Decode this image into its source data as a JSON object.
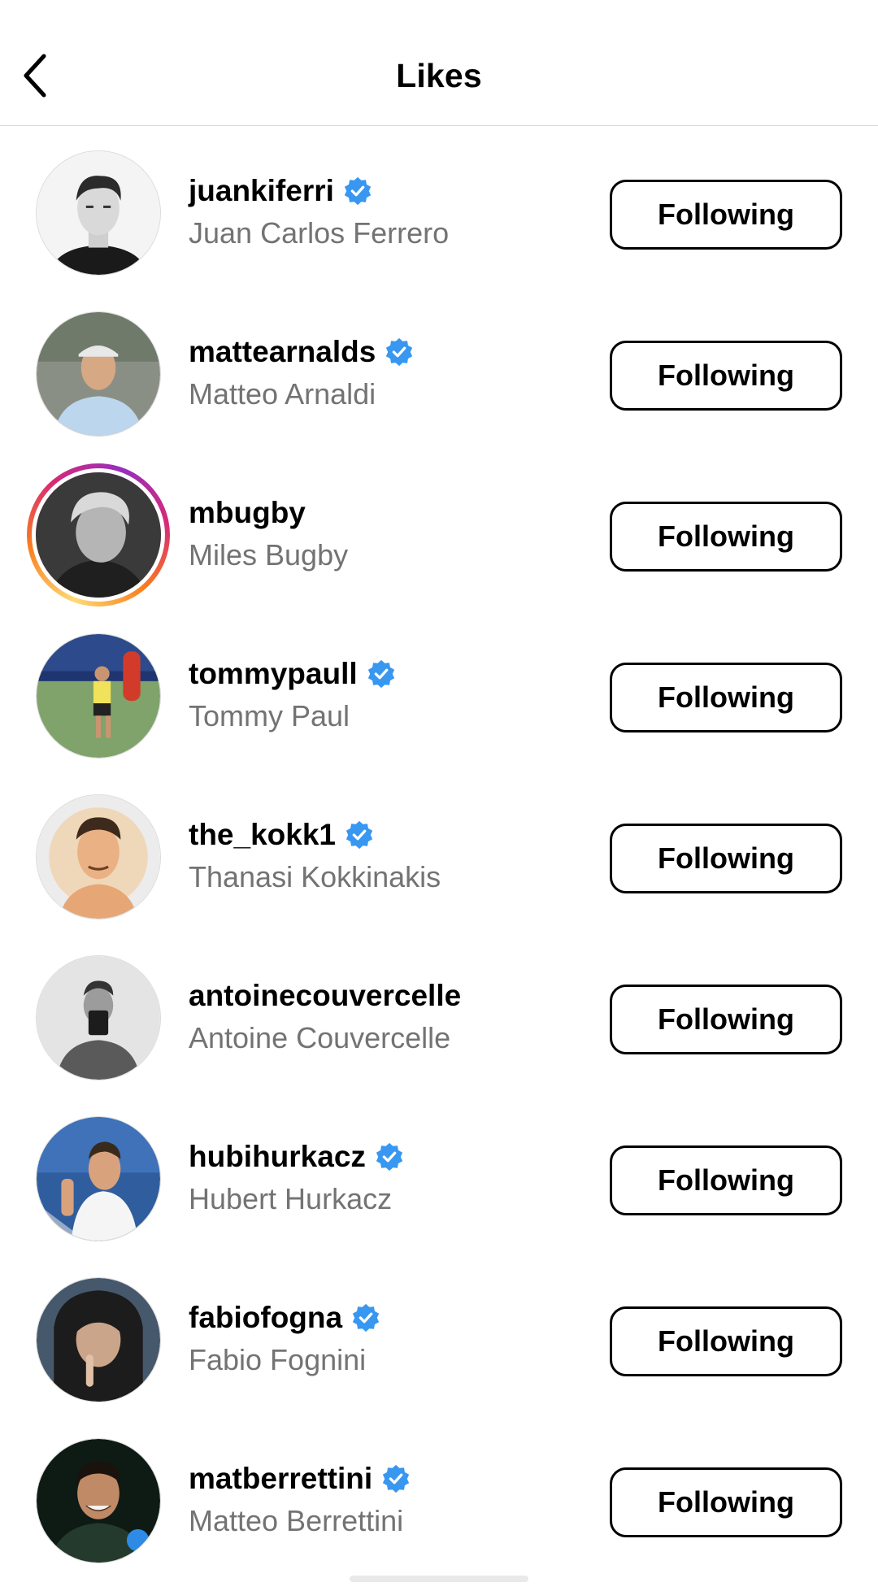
{
  "header": {
    "title": "Likes",
    "back_icon": "chevron-left-icon"
  },
  "colors": {
    "verified_badge": "#3897f0",
    "secondary_text": "#737373",
    "divider": "#dbdbdb",
    "story_ring": [
      "#feda75",
      "#fa7e1e",
      "#d62976",
      "#962fbf"
    ]
  },
  "likes": [
    {
      "username": "juankiferri",
      "full_name": "Juan Carlos Ferrero",
      "verified": true,
      "story_ring": false,
      "button_label": "Following"
    },
    {
      "username": "mattearnalds",
      "full_name": "Matteo Arnaldi",
      "verified": true,
      "story_ring": false,
      "button_label": "Following"
    },
    {
      "username": "mbugby",
      "full_name": "Miles Bugby",
      "verified": false,
      "story_ring": true,
      "button_label": "Following"
    },
    {
      "username": "tommypaull",
      "full_name": "Tommy Paul",
      "verified": true,
      "story_ring": false,
      "button_label": "Following"
    },
    {
      "username": "the_kokk1",
      "full_name": "Thanasi Kokkinakis",
      "verified": true,
      "story_ring": false,
      "button_label": "Following"
    },
    {
      "username": "antoinecouvercelle",
      "full_name": "Antoine Couvercelle",
      "verified": false,
      "story_ring": false,
      "button_label": "Following"
    },
    {
      "username": "hubihurkacz",
      "full_name": "Hubert Hurkacz",
      "verified": true,
      "story_ring": false,
      "button_label": "Following"
    },
    {
      "username": "fabiofogna",
      "full_name": "Fabio Fognini",
      "verified": true,
      "story_ring": false,
      "button_label": "Following"
    },
    {
      "username": "matberrettini",
      "full_name": "Matteo Berrettini",
      "verified": true,
      "story_ring": false,
      "button_label": "Following"
    }
  ]
}
